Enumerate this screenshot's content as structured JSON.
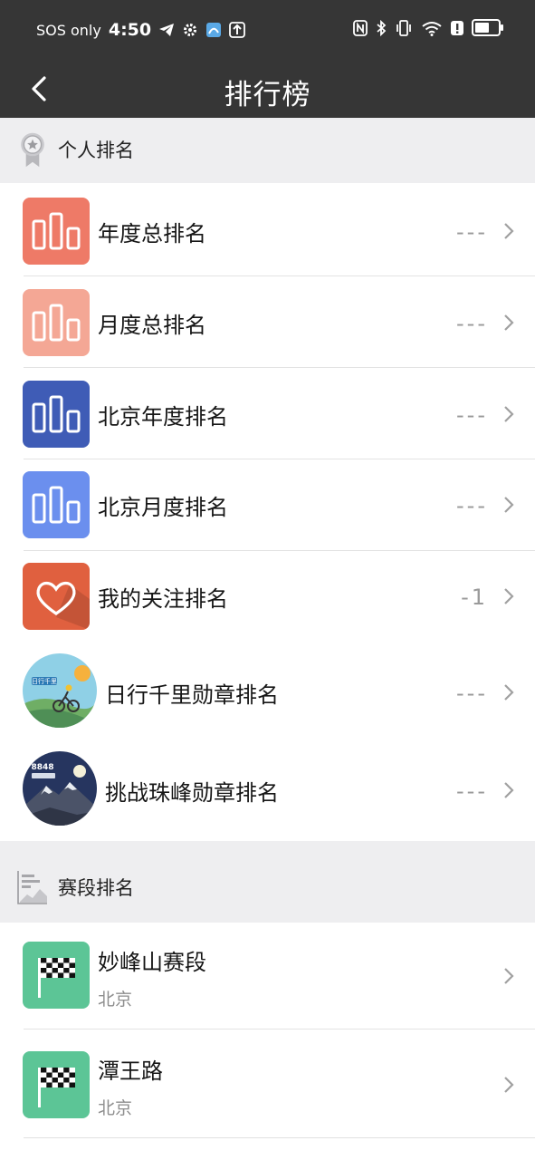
{
  "status_bar": {
    "sos_text": "SOS only",
    "time": "4:50",
    "battery_level": 0.75
  },
  "navbar": {
    "title": "排行榜",
    "back_icon": "chevron-left-icon"
  },
  "personal_section": {
    "label": "个人排名",
    "icon": "medal-icon",
    "items": [
      {
        "label": "年度总排名",
        "value": "---",
        "icon": "bar-chart-icon",
        "color": "#ee7a67"
      },
      {
        "label": "月度总排名",
        "value": "---",
        "icon": "bar-chart-icon",
        "color": "#f4a795"
      },
      {
        "label": "北京年度排名",
        "value": "---",
        "icon": "bar-chart-icon",
        "color": "#3f5cb6"
      },
      {
        "label": "北京月度排名",
        "value": "---",
        "icon": "bar-chart-icon",
        "color": "#6b8fee"
      },
      {
        "label": "我的关注排名",
        "value": "-1",
        "icon": "heart-icon",
        "color": "#e0603f"
      },
      {
        "label": "日行千里勋章排名",
        "value": "---",
        "icon": "cycling-badge-icon",
        "badge_text": "日行千里"
      },
      {
        "label": "挑战珠峰勋章排名",
        "value": "---",
        "icon": "mountain-badge-icon",
        "badge_text": "8848"
      }
    ]
  },
  "segment_section": {
    "label": "赛段排名",
    "icon": "segment-chart-icon",
    "items": [
      {
        "label": "妙峰山赛段",
        "sub": "北京",
        "icon": "checkered-flag-icon",
        "color": "#5cc596"
      },
      {
        "label": "潭王路",
        "sub": "北京",
        "icon": "checkered-flag-icon",
        "color": "#5cc596"
      }
    ]
  },
  "colors": {
    "header_bg": "#363636",
    "section_bg": "#eeeef0",
    "flag_tile": "#5cc596"
  }
}
